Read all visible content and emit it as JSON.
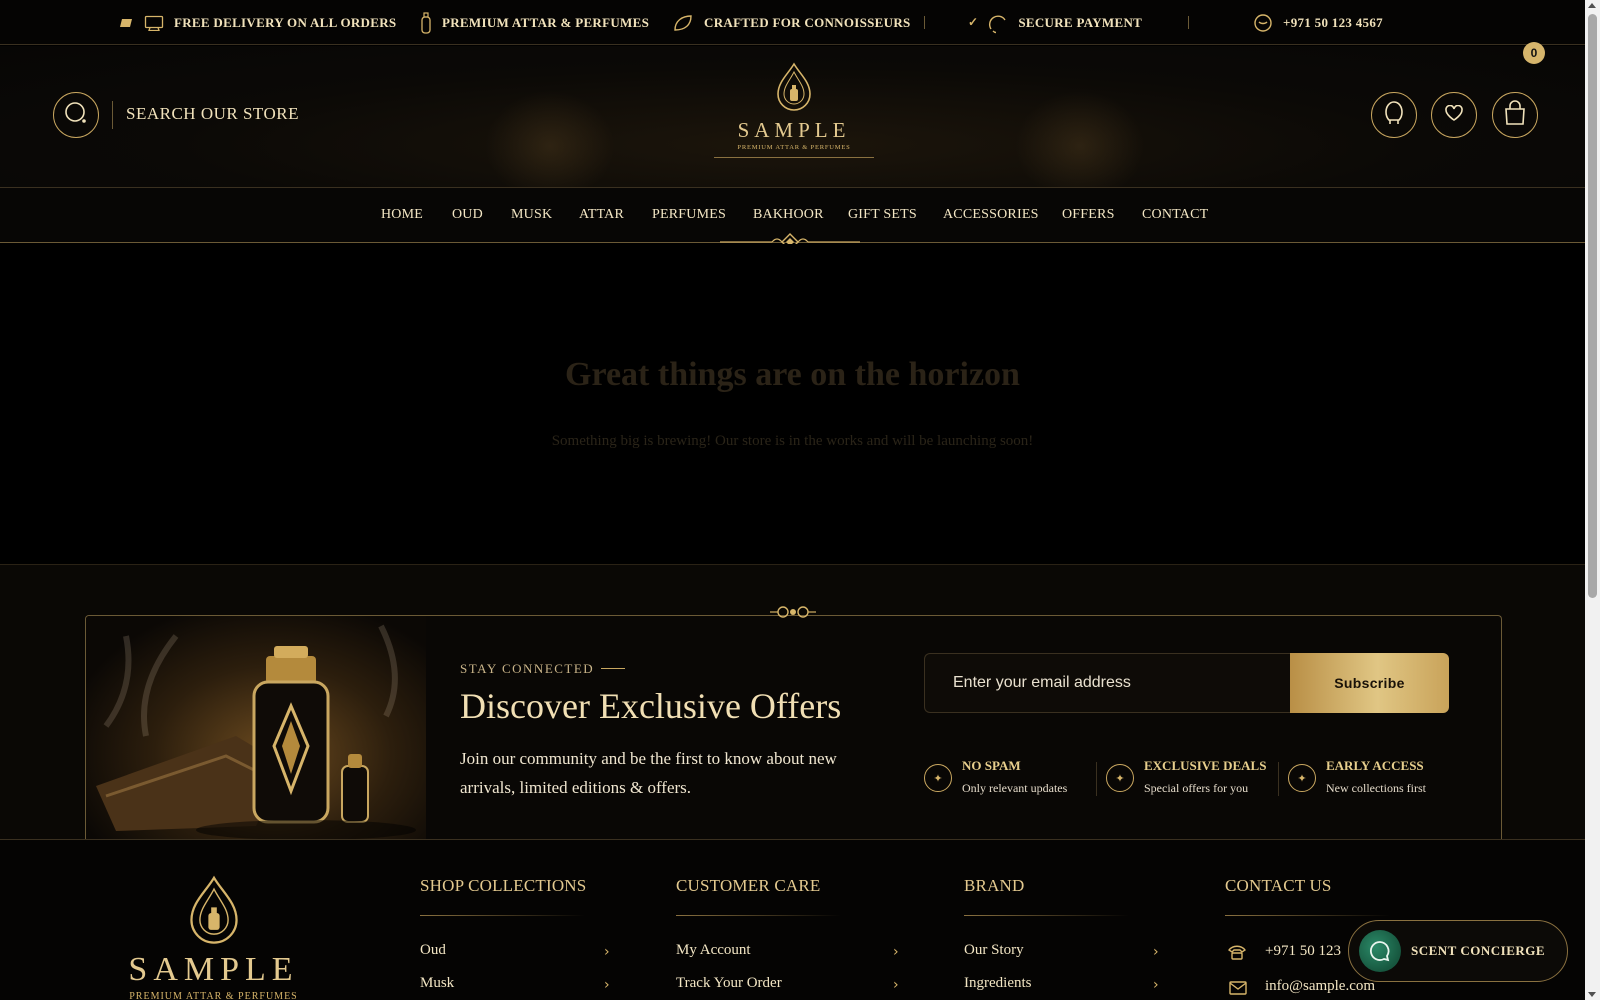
{
  "announcement": {
    "items": [
      {
        "label": "FREE DELIVERY ON ALL ORDERS",
        "icon": "delivery-icon"
      },
      {
        "label": "PREMIUM ATTAR & PERFUMES",
        "icon": "bottle-icon"
      },
      {
        "label": "CRAFTED FOR CONNOISSEURS",
        "icon": "leaf-icon"
      },
      {
        "label": "SECURE PAYMENT",
        "icon": "shield-icon"
      },
      {
        "label": "+971 50 123 4567",
        "icon": "phone-icon"
      }
    ]
  },
  "header": {
    "search_label": "SEARCH OUR STORE",
    "logo": {
      "name": "SAMPLE",
      "tagline": "PREMIUM ATTAR & PERFUMES"
    },
    "cart_count": "0",
    "icons": [
      "search-icon",
      "account-icon",
      "wishlist-icon",
      "cart-icon"
    ]
  },
  "nav": {
    "items": [
      "HOME",
      "OUD",
      "MUSK",
      "ATTAR",
      "PERFUMES",
      "BAKHOOR",
      "GIFT SETS",
      "ACCESSORIES",
      "OFFERS",
      "CONTACT"
    ]
  },
  "hero": {
    "title": "Great things are on the horizon",
    "subtitle": "Something big is brewing! Our store is in the works and will be launching soon!"
  },
  "newsletter": {
    "eyebrow": "STAY CONNECTED",
    "title": "Discover Exclusive Offers",
    "description": "Join our community and be the first to know about new arrivals, limited editions & offers.",
    "email_placeholder": "Enter your email address",
    "subscribe_label": "Subscribe",
    "features": [
      {
        "title": "NO SPAM",
        "subtitle": "Only relevant updates"
      },
      {
        "title": "EXCLUSIVE DEALS",
        "subtitle": "Special offers for you"
      },
      {
        "title": "EARLY ACCESS",
        "subtitle": "New collections first"
      }
    ]
  },
  "footer": {
    "logo": {
      "name": "SAMPLE",
      "tagline": "PREMIUM ATTAR & PERFUMES"
    },
    "columns": [
      {
        "title": "SHOP COLLECTIONS",
        "links": [
          "Oud",
          "Musk"
        ]
      },
      {
        "title": "CUSTOMER CARE",
        "links": [
          "My Account",
          "Track Your Order"
        ]
      },
      {
        "title": "BRAND",
        "links": [
          "Our Story",
          "Ingredients"
        ]
      },
      {
        "title": "CONTACT US",
        "links": [
          "+971 50 123",
          "info@sample.com"
        ]
      }
    ]
  },
  "concierge": {
    "label": "SCENT CONCIERGE"
  },
  "colors": {
    "accent": "#d7b56a",
    "background": "#000000",
    "button_gold": "#e0c684",
    "concierge_green": "#2b8a68"
  }
}
